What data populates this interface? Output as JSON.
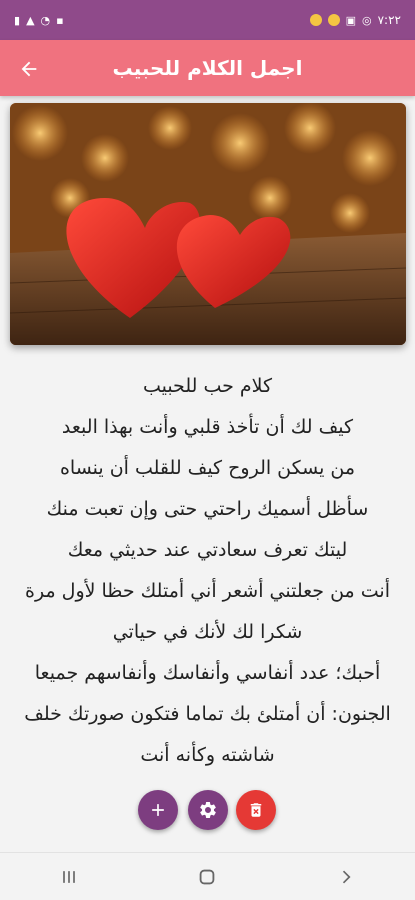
{
  "status_bar": {
    "time": "٧:٢٢",
    "left_text": "⊙ ⊟ ● ●",
    "right_text": "▮▮ ⟰ ▯"
  },
  "app_bar": {
    "title": "اجمل الكلام للحبيب",
    "back_icon": "arrow-left-icon"
  },
  "hero_image": {
    "description_icon": "hearts-image"
  },
  "content": {
    "lines": [
      "كلام حب للحبيب",
      "كيف لك أن تأخذ قلبي وأنت بهذا البعد",
      "من يسكن الروح كيف للقلب أن ينساه",
      "سأظل أسميك راحتي حتى وإن تعبت منك",
      "ليتك تعرف سعادتي عند حديثي معك",
      "أنت من جعلتني أشعر أني أمتلك حظا لأول مرة",
      "شكرا لك لأنك في حياتي",
      "أحبك؛ عدد أنفاسي وأنفاسك وأنفاسهم جميعا",
      "الجنون: أن أمتلئ بك تماما فتكون صورتك خلف شاشته وكأنه أنت"
    ]
  },
  "fabs": {
    "add_icon": "plus-icon",
    "settings_icon": "gear-icon",
    "delete_icon": "trash-icon"
  },
  "colors": {
    "status_bar": "#8f4a8a",
    "app_bar": "#f0727f",
    "fab_purple": "#7d3d80",
    "fab_red": "#e53935"
  }
}
